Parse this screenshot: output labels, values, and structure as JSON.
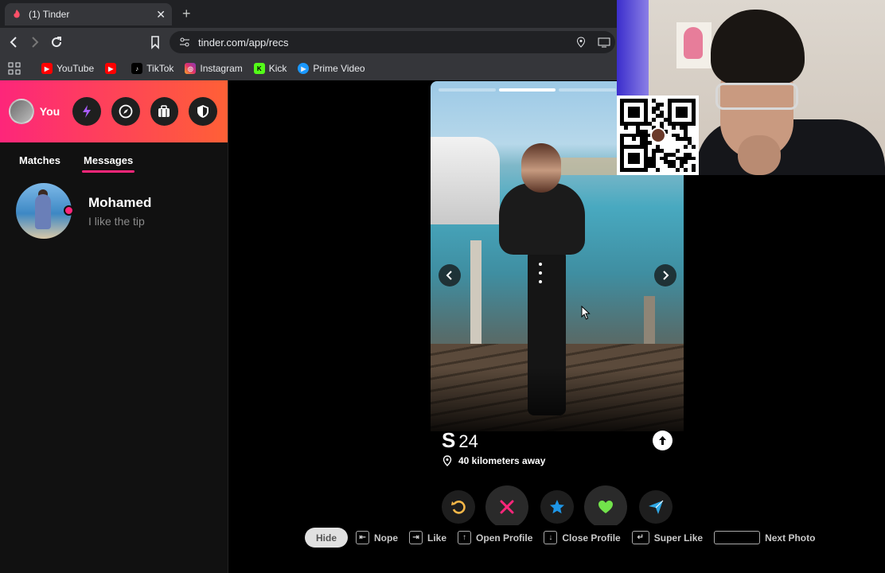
{
  "browser": {
    "tab_title": "(1) Tinder",
    "tab_close": "✕",
    "new_tab": "+",
    "url": "tinder.com/app/recs",
    "bookmarks": [
      "YouTube",
      "TikTok",
      "Instagram",
      "Kick",
      "Prime Video"
    ]
  },
  "sidebar": {
    "me_label": "You",
    "tabs": [
      "Matches",
      "Messages"
    ],
    "active_tab": "Messages",
    "conversation": {
      "name": "Mohamed",
      "last_message": "I like the tip"
    }
  },
  "profile": {
    "name": "S",
    "age": "24",
    "distance": "40 kilometers away",
    "photo_count": 4,
    "current_photo": 2
  },
  "actions": [
    "rewind-icon",
    "nope-icon",
    "super-like-icon",
    "like-icon",
    "boost-icon"
  ],
  "hints": {
    "hide": "Hide",
    "nope": "Nope",
    "like": "Like",
    "open_profile": "Open Profile",
    "close_profile": "Close Profile",
    "super_like": "Super Like",
    "next_photo": "Next Photo"
  },
  "colors": {
    "brand_gradient_start": "#fd267a",
    "brand_gradient_end": "#ff6036",
    "nope": "#fd267a",
    "rewind": "#f5b748",
    "super_like": "#1e96e6",
    "like": "#72e34b",
    "boost": "#2fa8e6"
  }
}
